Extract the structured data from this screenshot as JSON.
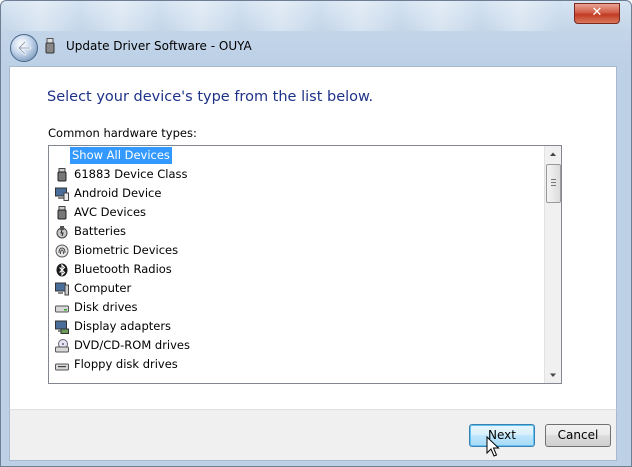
{
  "window": {
    "title": "Update Driver Software - OUYA",
    "close_label": "✕"
  },
  "content": {
    "heading": "Select your device's type from the list below.",
    "list_label": "Common hardware types:"
  },
  "device_types": [
    {
      "label": "Show All Devices",
      "icon": "none",
      "selected": true
    },
    {
      "label": "61883 Device Class",
      "icon": "firewire-icon"
    },
    {
      "label": "Android Device",
      "icon": "android-device-icon"
    },
    {
      "label": "AVC Devices",
      "icon": "avc-device-icon"
    },
    {
      "label": "Batteries",
      "icon": "battery-icon"
    },
    {
      "label": "Biometric Devices",
      "icon": "biometric-icon"
    },
    {
      "label": "Bluetooth Radios",
      "icon": "bluetooth-icon"
    },
    {
      "label": "Computer",
      "icon": "computer-icon"
    },
    {
      "label": "Disk drives",
      "icon": "disk-drive-icon"
    },
    {
      "label": "Display adapters",
      "icon": "display-adapter-icon"
    },
    {
      "label": "DVD/CD-ROM drives",
      "icon": "dvd-drive-icon"
    },
    {
      "label": "Floppy disk drives",
      "icon": "floppy-drive-icon"
    }
  ],
  "buttons": {
    "next": "Next",
    "cancel": "Cancel"
  }
}
